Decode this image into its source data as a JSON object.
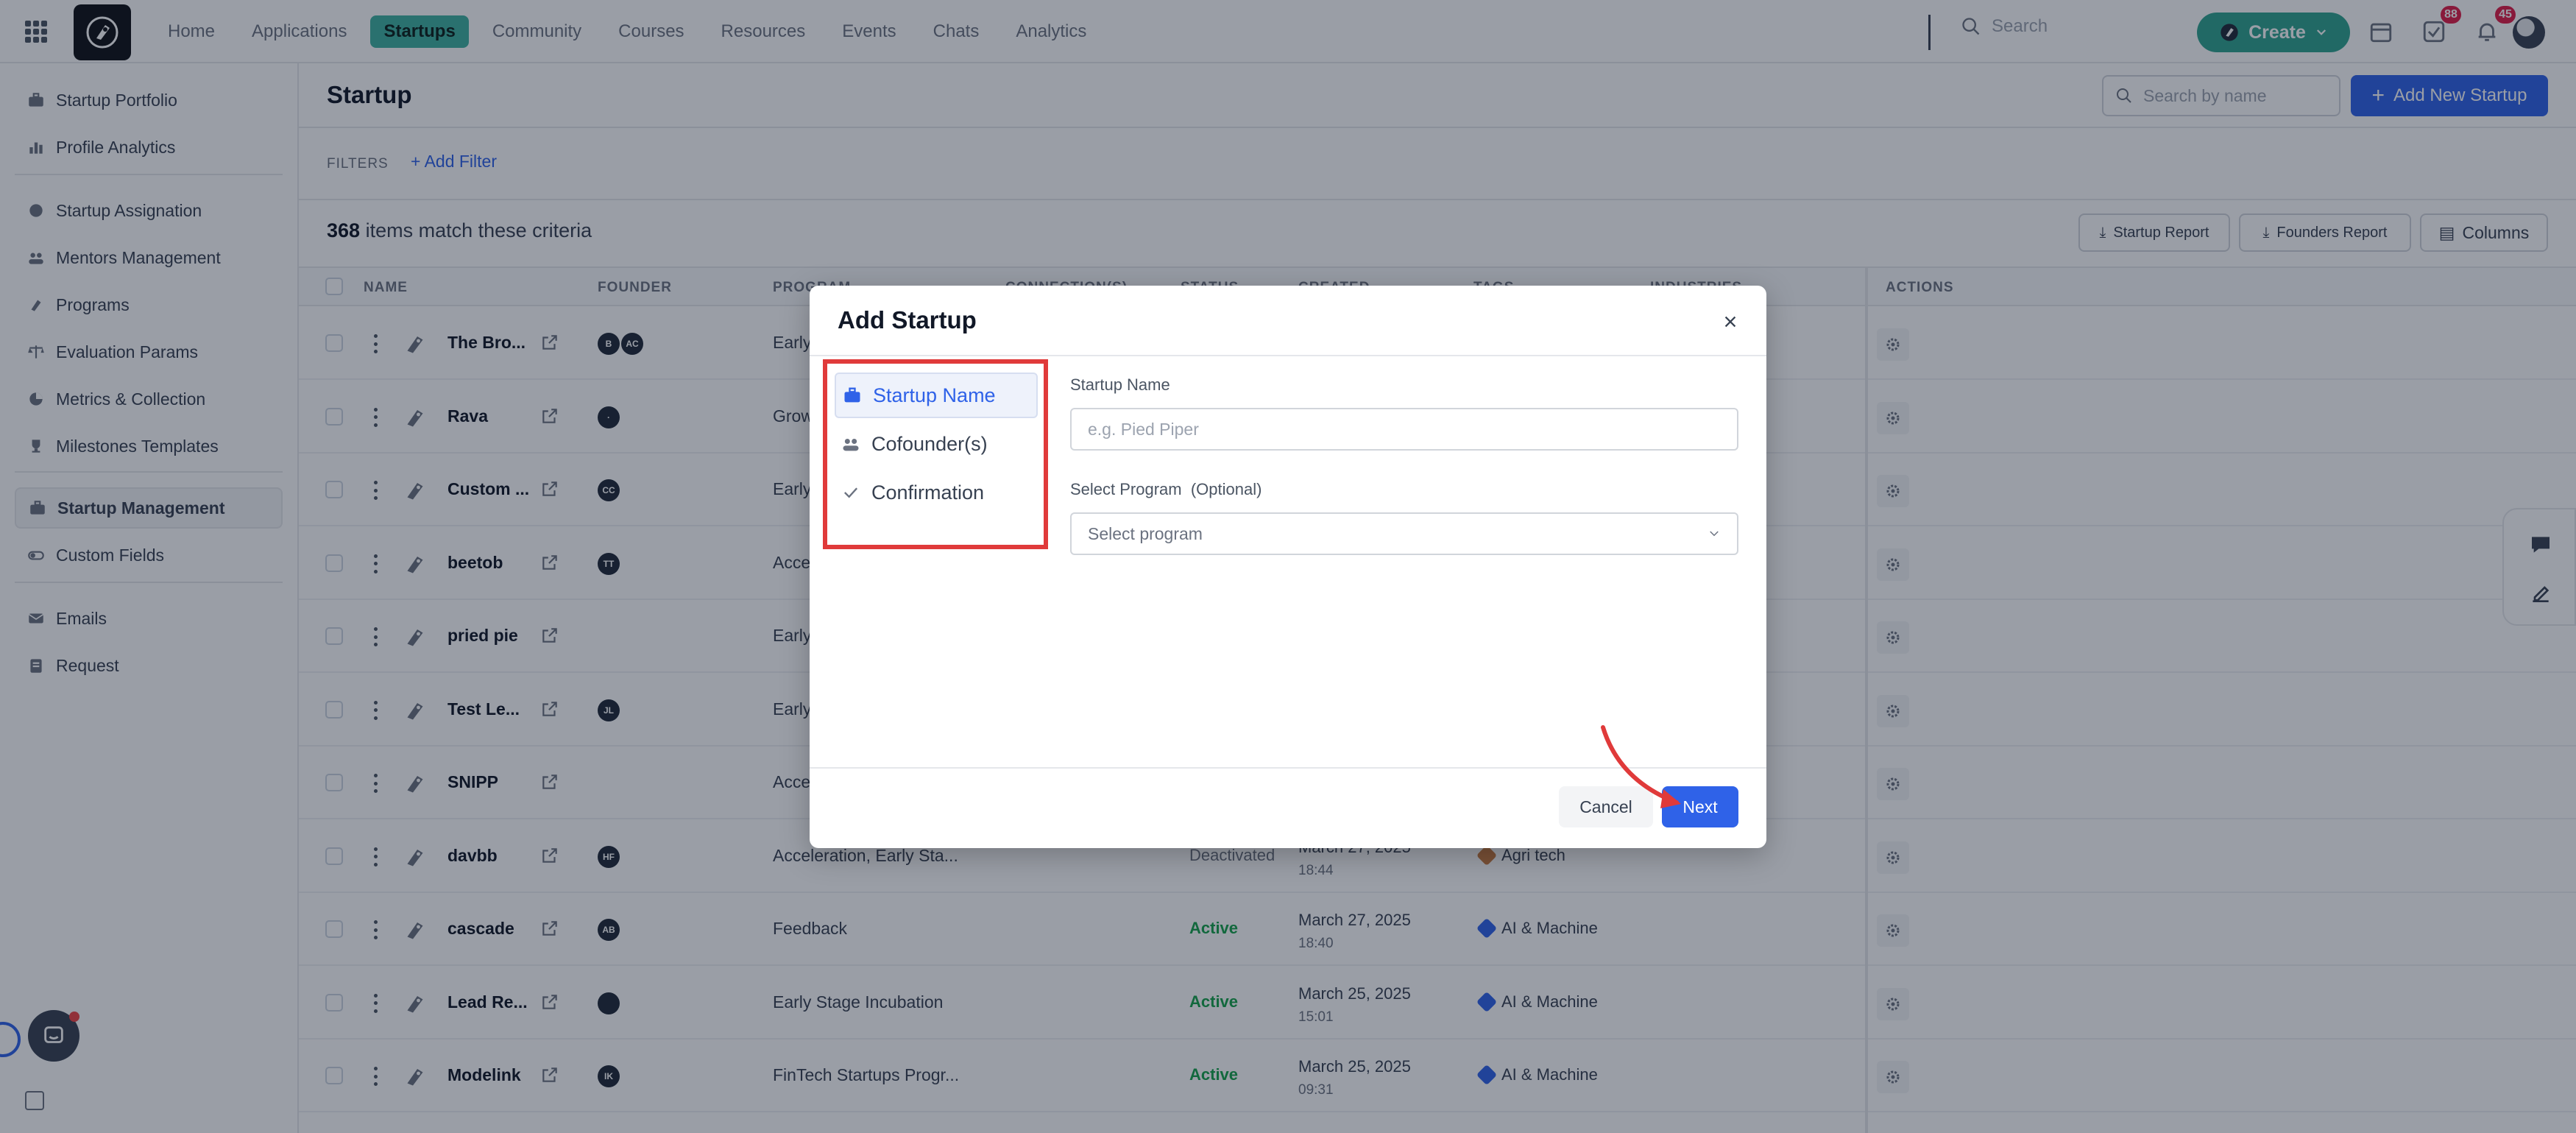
{
  "topnav": {
    "items": [
      "Home",
      "Applications",
      "Startups",
      "Community",
      "Courses",
      "Resources",
      "Events",
      "Chats",
      "Analytics"
    ],
    "active_index": 2,
    "search_placeholder": "Search",
    "create_label": "Create",
    "tasks_badge": "88",
    "notifications_badge": "45"
  },
  "sidebar": {
    "items": [
      {
        "label": "Startup Portfolio",
        "icon": "briefcase-icon"
      },
      {
        "label": "Profile Analytics",
        "icon": "bar-chart-icon"
      },
      {
        "label": "Startup Assignation",
        "icon": "circle-icon"
      },
      {
        "label": "Mentors Management",
        "icon": "users-icon"
      },
      {
        "label": "Programs",
        "icon": "rocket-icon"
      },
      {
        "label": "Evaluation Params",
        "icon": "scale-icon"
      },
      {
        "label": "Metrics & Collection",
        "icon": "pie-chart-icon"
      },
      {
        "label": "Milestones Templates",
        "icon": "trophy-icon"
      },
      {
        "label": "Startup Management",
        "icon": "briefcase-icon"
      },
      {
        "label": "Custom Fields",
        "icon": "toggle-icon"
      },
      {
        "label": "Emails",
        "icon": "mail-icon"
      },
      {
        "label": "Request",
        "icon": "clipboard-icon"
      }
    ],
    "active_index": 8
  },
  "main": {
    "title": "Startup",
    "search_placeholder": "Search by name",
    "add_new_label": "Add New Startup",
    "filters_label": "FILTERS",
    "add_filter_label": "Add Filter",
    "count": "368",
    "count_suffix": "items match these criteria",
    "buttons": {
      "startup_report": "Startup Report",
      "founders_report": "Founders Report",
      "columns": "Columns"
    },
    "columns": [
      "NAME",
      "FOUNDER",
      "PROGRAM",
      "CONNECTION(S)",
      "STATUS",
      "CREATED",
      "TAGS",
      "INDUSTRIES",
      "ACTIONS"
    ],
    "rows": [
      {
        "name": "The Bro...",
        "founders": [
          "B",
          "AC"
        ],
        "program": "Early",
        "status": "",
        "created": "",
        "time": "",
        "tag": ""
      },
      {
        "name": "Rava",
        "founders": [
          "·"
        ],
        "program": "Grow",
        "status": "",
        "created": "",
        "time": "",
        "tag": ""
      },
      {
        "name": "Custom ...",
        "founders": [
          "CC"
        ],
        "program": "Early",
        "status": "",
        "created": "",
        "time": "",
        "tag": ""
      },
      {
        "name": "beetob",
        "founders": [
          "TT"
        ],
        "program": "Accele",
        "status": "",
        "created": "",
        "time": "",
        "tag": ""
      },
      {
        "name": "pried pie",
        "founders": [],
        "program": "Early",
        "status": "",
        "created": "",
        "time": "",
        "tag": ""
      },
      {
        "name": "Test Le...",
        "founders": [
          "JL"
        ],
        "program": "Early",
        "status": "",
        "created": "",
        "time": "",
        "tag": ""
      },
      {
        "name": "SNIPP",
        "founders": [],
        "program": "Acce",
        "status": "",
        "created": "",
        "time": "",
        "tag": ""
      },
      {
        "name": "davbb",
        "founders": [
          "HF"
        ],
        "program": "Acceleration, Early Sta...",
        "status": "Deactivated",
        "created": "March 27, 2025",
        "time": "18:44",
        "tag": "Agri tech"
      },
      {
        "name": "cascade",
        "founders": [
          "AB"
        ],
        "program": "Feedback",
        "status": "Active",
        "created": "March 27, 2025",
        "time": "18:40",
        "tag": "AI & Machine"
      },
      {
        "name": "Lead Re...",
        "founders": [
          ""
        ],
        "program": "Early Stage Incubation",
        "status": "Active",
        "created": "March 25, 2025",
        "time": "15:01",
        "tag": "AI & Machine"
      },
      {
        "name": "Modelink",
        "founders": [
          "IK"
        ],
        "program": "FinTech Startups Progr...",
        "status": "Active",
        "created": "March 25, 2025",
        "time": "09:31",
        "tag": "AI & Machine"
      }
    ]
  },
  "modal": {
    "title": "Add Startup",
    "steps": [
      {
        "label": "Startup Name",
        "icon": "briefcase-icon"
      },
      {
        "label": "Cofounder(s)",
        "icon": "users-icon"
      },
      {
        "label": "Confirmation",
        "icon": "check-icon"
      }
    ],
    "active_step": 0,
    "name_label": "Startup Name",
    "name_placeholder": "e.g. Pied Piper",
    "program_label": "Select Program",
    "program_optional": "(Optional)",
    "program_placeholder": "Select program",
    "cancel_label": "Cancel",
    "next_label": "Next"
  },
  "colors": {
    "accent": "#2f62e8",
    "brand": "#3fb2a1",
    "highlight": "#e03a3a",
    "active_status": "#16a34a"
  }
}
